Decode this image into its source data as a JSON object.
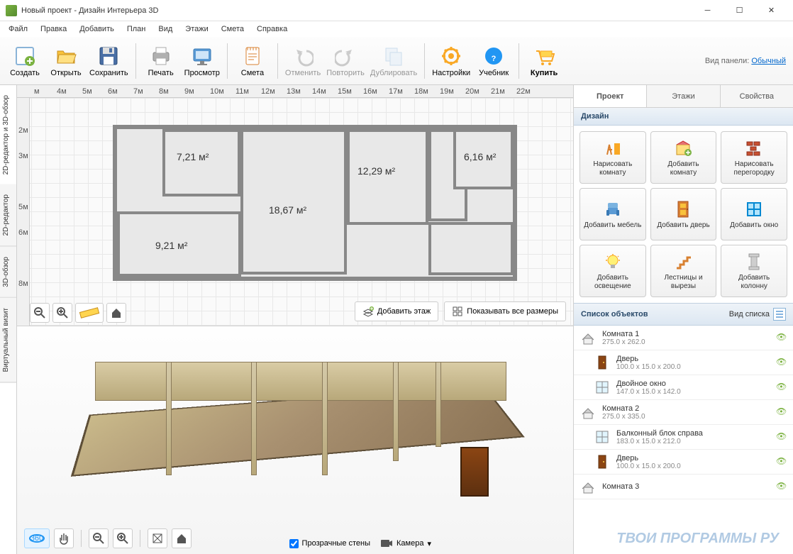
{
  "window": {
    "title": "Новый проект - Дизайн Интерьера 3D"
  },
  "menu": [
    "Файл",
    "Правка",
    "Добавить",
    "План",
    "Вид",
    "Этажи",
    "Смета",
    "Справка"
  ],
  "toolbar": {
    "create": "Создать",
    "open": "Открыть",
    "save": "Сохранить",
    "print": "Печать",
    "preview": "Просмотр",
    "estimate": "Смета",
    "undo": "Отменить",
    "redo": "Повторить",
    "duplicate": "Дублировать",
    "settings": "Настройки",
    "tutorial": "Учебник",
    "buy": "Купить",
    "panel_label": "Вид панели:",
    "panel_mode": "Обычный"
  },
  "left_tabs": [
    "2D-редактор и 3D-обзор",
    "2D-редактор",
    "3D-обзор",
    "Виртуальный визит"
  ],
  "ruler_h": [
    "м",
    "4м",
    "5м",
    "6м",
    "7м",
    "8м",
    "9м",
    "10м",
    "11м",
    "12м",
    "13м",
    "14м",
    "15м",
    "16м",
    "17м",
    "18м",
    "19м",
    "20м",
    "21м",
    "22м"
  ],
  "ruler_v": [
    "2м",
    "3м",
    "5м",
    "6м",
    "8м"
  ],
  "rooms": {
    "r1": "7,21 м²",
    "r2": "18,67 м²",
    "r3": "12,29 м²",
    "r4": "9,21 м²",
    "r5": "6,16 м²"
  },
  "plan_actions": {
    "add_floor": "Добавить этаж",
    "show_sizes": "Показывать все размеры"
  },
  "view3d": {
    "transparent": "Прозрачные стены",
    "camera": "Камера"
  },
  "right_tabs": [
    "Проект",
    "Этажи",
    "Свойства"
  ],
  "design_hdr": "Дизайн",
  "tools": [
    {
      "label": "Нарисовать комнату"
    },
    {
      "label": "Добавить комнату"
    },
    {
      "label": "Нарисовать перегородку"
    },
    {
      "label": "Добавить мебель"
    },
    {
      "label": "Добавить дверь"
    },
    {
      "label": "Добавить окно"
    },
    {
      "label": "Добавить освещение"
    },
    {
      "label": "Лестницы и вырезы"
    },
    {
      "label": "Добавить колонну"
    }
  ],
  "list_hdr": "Список объектов",
  "list_mode": "Вид списка",
  "objects": [
    {
      "name": "Комната 1",
      "dim": "275.0 x 262.0",
      "type": "room"
    },
    {
      "name": "Дверь",
      "dim": "100.0 x 15.0 x 200.0",
      "type": "door",
      "child": true
    },
    {
      "name": "Двойное окно",
      "dim": "147.0 x 15.0 x 142.0",
      "type": "window",
      "child": true
    },
    {
      "name": "Комната 2",
      "dim": "275.0 x 335.0",
      "type": "room"
    },
    {
      "name": "Балконный блок справа",
      "dim": "183.0 x 15.0 x 212.0",
      "type": "window",
      "child": true
    },
    {
      "name": "Дверь",
      "dim": "100.0 x 15.0 x 200.0",
      "type": "door",
      "child": true
    },
    {
      "name": "Комната 3",
      "dim": "",
      "type": "room"
    }
  ],
  "watermark": "ТВОИ ПРОГРАММЫ РУ"
}
